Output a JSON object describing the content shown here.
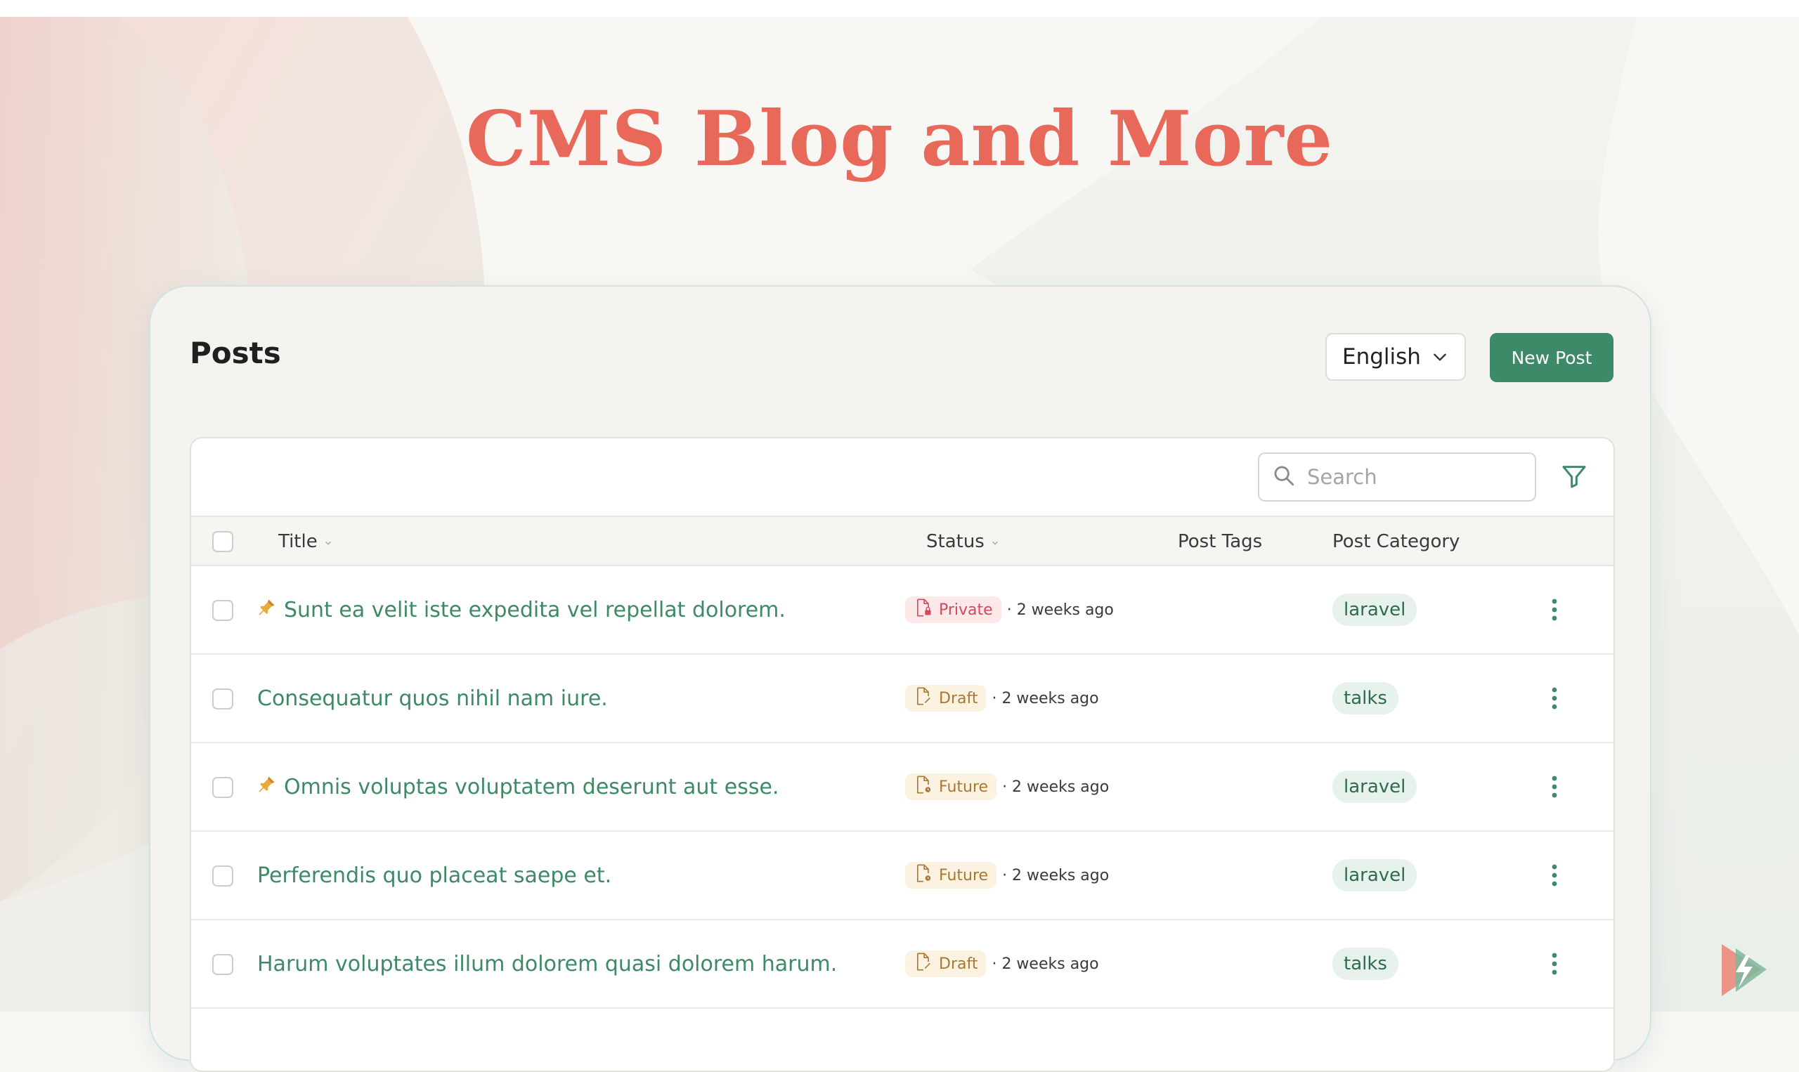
{
  "hero": {
    "title": "CMS Blog and More"
  },
  "panel": {
    "title": "Posts",
    "language_select": {
      "value": "English"
    },
    "new_post_label": "New Post"
  },
  "table": {
    "search_placeholder": "Search",
    "columns": [
      "Title",
      "Status",
      "Post Tags",
      "Post Category"
    ],
    "rows": [
      {
        "pinned": true,
        "title": "Sunt ea velit iste expedita vel repellat dolorem.",
        "status": "Private",
        "status_type": "private",
        "time": "· 2 weeks ago",
        "tags": "",
        "category": "laravel"
      },
      {
        "pinned": false,
        "title": "Consequatur quos nihil nam iure.",
        "status": "Draft",
        "status_type": "draft",
        "time": "· 2 weeks ago",
        "tags": "",
        "category": "talks"
      },
      {
        "pinned": true,
        "title": "Omnis voluptas voluptatem deserunt aut esse.",
        "status": "Future",
        "status_type": "future",
        "time": "· 2 weeks ago",
        "tags": "",
        "category": "laravel"
      },
      {
        "pinned": false,
        "title": "Perferendis quo placeat saepe et.",
        "status": "Future",
        "status_type": "future",
        "time": "· 2 weeks ago",
        "tags": "",
        "category": "laravel"
      },
      {
        "pinned": false,
        "title": "Harum voluptates illum dolorem quasi dolorem harum.",
        "status": "Draft",
        "status_type": "draft",
        "time": "· 2 weeks ago",
        "tags": "",
        "category": "talks"
      }
    ]
  },
  "icons": {
    "search": "search-icon",
    "filter": "filter-icon",
    "chevron": "chevron-down-icon",
    "sort": "sort-icon",
    "pin": "pin-icon",
    "status_doc": "document-status-icon",
    "actions": "more-vertical-icon",
    "brand": "lightning-logo-icon"
  },
  "colors": {
    "accent": "#e8695a",
    "primary_button": "#3c8a68",
    "title_link": "#3d8a65",
    "private": "#d04a5c",
    "draft_future": "#a97830",
    "category_bg": "#e7f2ec"
  }
}
